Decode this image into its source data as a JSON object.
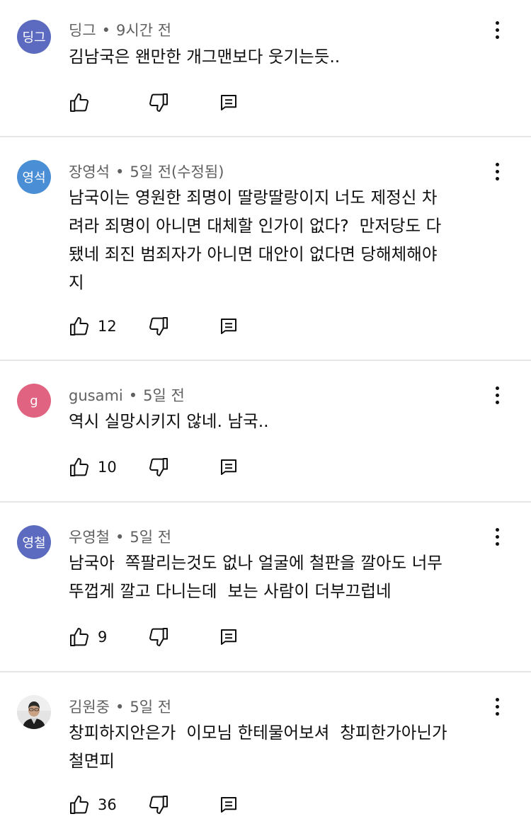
{
  "comments": [
    {
      "avatar_text": "딩그",
      "avatar_color": "#5c6bc0",
      "author": "딩그",
      "time": "9시간 전",
      "text": "김남국은 왠만한 개그맨보다 웃기는듯..",
      "likes": ""
    },
    {
      "avatar_text": "영석",
      "avatar_color": "#4a8fd6",
      "author": "장영석",
      "time": "5일 전(수정됨)",
      "text": "남국이는 영원한 죄명이 딸랑딸랑이지 너도 제정신 차\n려라 죄명이 아니면 대체할 인가이 없다?  만저당도 다\n됐네 죄진 범죄자가 아니면 대안이 없다면 당해체해야\n지",
      "likes": "12"
    },
    {
      "avatar_text": "g",
      "avatar_color": "#e06482",
      "author": "gusami",
      "time": "5일 전",
      "text": "역시 실망시키지 않네. 남국..",
      "likes": "10"
    },
    {
      "avatar_text": "영철",
      "avatar_color": "#5c6bc0",
      "author": "우영철",
      "time": "5일 전",
      "text": "남국아  쪽팔리는것도 없나 얼굴에 철판을 깔아도 너무\n뚜껍게 깔고 다니는데  보는 사람이 더부끄럽네",
      "likes": "9"
    },
    {
      "avatar_text": "",
      "avatar_color": "#d9d9d9",
      "author": "김원중",
      "time": "5일 전",
      "text": "창피하지안은가  이모님 한테물어보셔  창피한가아닌가\n철면피",
      "likes": "36"
    }
  ],
  "separator": "•"
}
